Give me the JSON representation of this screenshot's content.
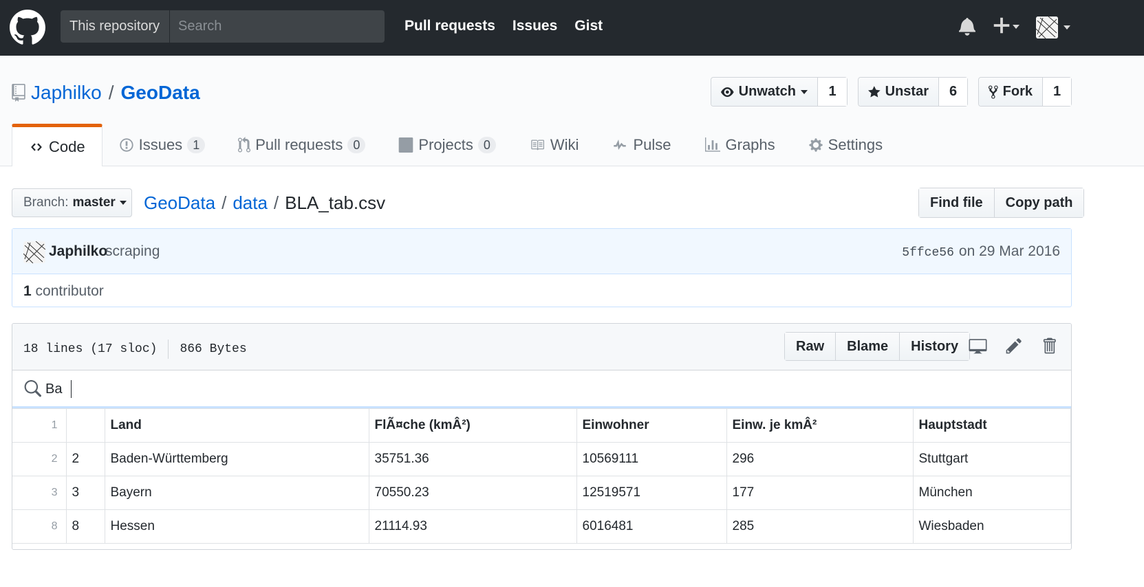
{
  "header": {
    "search_scope": "This repository",
    "search_placeholder": "Search",
    "nav": [
      "Pull requests",
      "Issues",
      "Gist"
    ]
  },
  "repo": {
    "owner": "Japhilko",
    "separator": "/",
    "name": "GeoData",
    "watch": {
      "label": "Unwatch",
      "count": "1"
    },
    "star": {
      "label": "Unstar",
      "count": "6"
    },
    "fork": {
      "label": "Fork",
      "count": "1"
    }
  },
  "tabs": [
    {
      "label": "Code",
      "icon": "code-icon"
    },
    {
      "label": "Issues",
      "count": "1",
      "icon": "issue-icon"
    },
    {
      "label": "Pull requests",
      "count": "0",
      "icon": "pull-request-icon"
    },
    {
      "label": "Projects",
      "count": "0",
      "icon": "project-icon"
    },
    {
      "label": "Wiki",
      "icon": "book-icon"
    },
    {
      "label": "Pulse",
      "icon": "pulse-icon"
    },
    {
      "label": "Graphs",
      "icon": "graph-icon"
    },
    {
      "label": "Settings",
      "icon": "gear-icon"
    }
  ],
  "file_nav": {
    "branch_label": "Branch:",
    "branch_value": "master",
    "path": [
      "GeoData",
      "data"
    ],
    "filename": "BLA_tab.csv",
    "find_file": "Find file",
    "copy_path": "Copy path"
  },
  "commit": {
    "author": "Japhilko",
    "message": "scraping",
    "sha": "5ffce56",
    "date": "on 29 Mar 2016",
    "contributors_count": "1",
    "contributors_label": "contributor"
  },
  "file": {
    "lines": "18 lines (17 sloc)",
    "size": "866 Bytes",
    "raw": "Raw",
    "blame": "Blame",
    "history": "History",
    "filter_value": "Ba",
    "columns": [
      "",
      "Land",
      "FlÃ¤che (kmÂ²)",
      "Einwohner",
      "Einw. je kmÂ²",
      "Hauptstadt"
    ],
    "rows": [
      {
        "line": "2",
        "cells": [
          "2",
          "Baden-Württemberg",
          "35751.36",
          "10569111",
          "296",
          "Stuttgart"
        ]
      },
      {
        "line": "3",
        "cells": [
          "3",
          "Bayern",
          "70550.23",
          "12519571",
          "177",
          "München"
        ]
      },
      {
        "line": "8",
        "cells": [
          "8",
          "Hessen",
          "21114.93",
          "6016481",
          "285",
          "Wiesbaden"
        ]
      }
    ],
    "header_line": "1"
  },
  "colors": {
    "link": "#0366d6",
    "tab_accent": "#e36209",
    "header_bg": "#24292e"
  }
}
